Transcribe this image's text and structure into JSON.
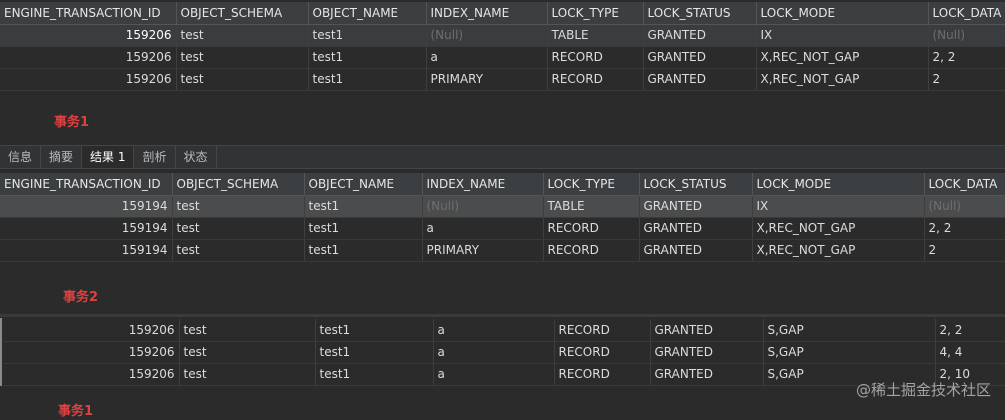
{
  "columns": [
    "ENGINE_TRANSACTION_ID",
    "OBJECT_SCHEMA",
    "OBJECT_NAME",
    "INDEX_NAME",
    "LOCK_TYPE",
    "LOCK_STATUS",
    "LOCK_MODE",
    "LOCK_DATA"
  ],
  "grid1": {
    "rows": [
      [
        "159206",
        "test",
        "test1",
        "(Null)",
        "TABLE",
        "GRANTED",
        "IX",
        "(Null)"
      ],
      [
        "159206",
        "test",
        "test1",
        "a",
        "RECORD",
        "GRANTED",
        "X,REC_NOT_GAP",
        "2, 2"
      ],
      [
        "159206",
        "test",
        "test1",
        "PRIMARY",
        "RECORD",
        "GRANTED",
        "X,REC_NOT_GAP",
        "2"
      ]
    ]
  },
  "label1": "事务1",
  "tabs": [
    {
      "label": "信息",
      "active": false
    },
    {
      "label": "摘要",
      "active": false
    },
    {
      "label": "结果 1",
      "active": true
    },
    {
      "label": "剖析",
      "active": false
    },
    {
      "label": "状态",
      "active": false
    }
  ],
  "grid2": {
    "rows": [
      [
        "159194",
        "test",
        "test1",
        "(Null)",
        "TABLE",
        "GRANTED",
        "IX",
        "(Null)"
      ],
      [
        "159194",
        "test",
        "test1",
        "a",
        "RECORD",
        "GRANTED",
        "X,REC_NOT_GAP",
        "2, 2"
      ],
      [
        "159194",
        "test",
        "test1",
        "PRIMARY",
        "RECORD",
        "GRANTED",
        "X,REC_NOT_GAP",
        "2"
      ]
    ]
  },
  "label2": "事务2",
  "grid3": {
    "rows": [
      [
        "159206",
        "test",
        "test1",
        "a",
        "RECORD",
        "GRANTED",
        "S,GAP",
        "2, 2"
      ],
      [
        "159206",
        "test",
        "test1",
        "a",
        "RECORD",
        "GRANTED",
        "S,GAP",
        "4, 4"
      ],
      [
        "159206",
        "test",
        "test1",
        "a",
        "RECORD",
        "GRANTED",
        "S,GAP",
        "2, 10"
      ]
    ]
  },
  "label3": "事务1",
  "watermark": "@稀土掘金技术社区"
}
